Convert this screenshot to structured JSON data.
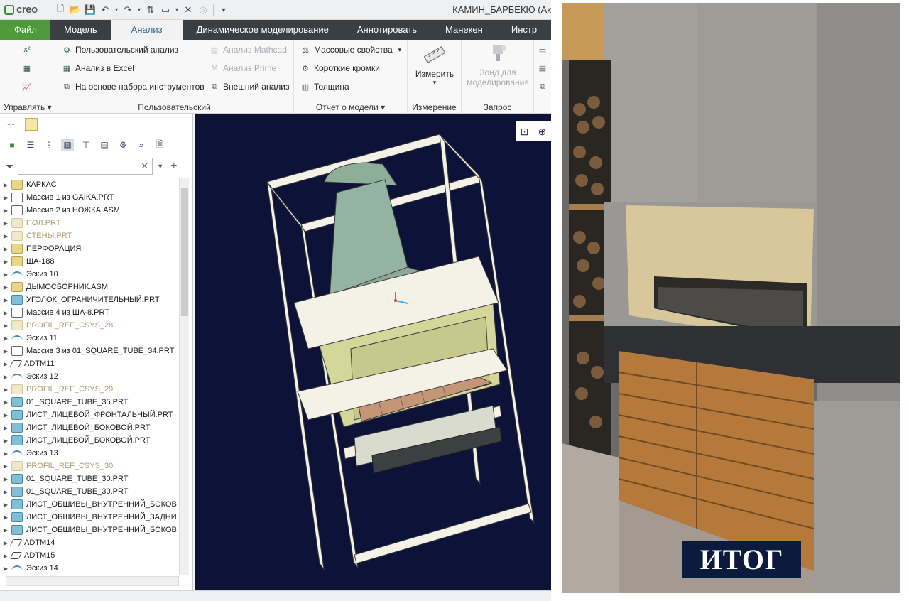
{
  "app": {
    "logo": "creo",
    "window_title": "КАМИН_БАРБЕКЮ (Ак"
  },
  "tabs": [
    {
      "label": "Файл"
    },
    {
      "label": "Модель"
    },
    {
      "label": "Анализ"
    },
    {
      "label": "Динамическое моделирование"
    },
    {
      "label": "Аннотировать"
    },
    {
      "label": "Манекен"
    },
    {
      "label": "Инстр"
    }
  ],
  "ribbon": {
    "manage_label": "Управлять",
    "custom": {
      "user_analysis": "Пользовательский анализ",
      "excel_analysis": "Анализ в Excel",
      "toolkit_analysis": "На основе набора инструментов",
      "mathcad_analysis": "Анализ Mathcad",
      "prime_analysis": "Анализ Prime",
      "external_analysis": "Внешний анализ",
      "group_label": "Пользовательский"
    },
    "model_report": {
      "mass_props": "Массовые свойства",
      "short_edges": "Короткие кромки",
      "thickness": "Толщина",
      "group_label": "Отчет о модели"
    },
    "measure": {
      "button": "Измерить",
      "group_label": "Измерение"
    },
    "query": {
      "button_line1": "Зонд для",
      "button_line2": "моделирования",
      "group_label": "Запрос"
    }
  },
  "tree": {
    "items": [
      {
        "label": "КАРКАС",
        "icon": "asm",
        "dim": false
      },
      {
        "label": "Массив 1 из GAIKA.PRT",
        "icon": "patt",
        "dim": false
      },
      {
        "label": "Массив 2 из НОЖКА.ASM",
        "icon": "patt",
        "dim": false
      },
      {
        "label": "ПОЛ.PRT",
        "icon": "ghost",
        "dim": true
      },
      {
        "label": "СТЕНЫ.PRT",
        "icon": "ghost",
        "dim": true
      },
      {
        "label": "ПЕРФОРАЦИЯ",
        "icon": "asm",
        "dim": false
      },
      {
        "label": "ША-188",
        "icon": "asm",
        "dim": false
      },
      {
        "label": "Эскиз 10",
        "icon": "sketch",
        "dim": false
      },
      {
        "label": "ДЫМОСБОРНИК.ASM",
        "icon": "asm",
        "dim": false
      },
      {
        "label": "УГОЛОК_ОГРАНИЧИТЕЛЬНЫЙ.PRT",
        "icon": "part",
        "dim": false
      },
      {
        "label": "Массив 4 из ША-8.PRT",
        "icon": "patt",
        "dim": false
      },
      {
        "label": "Эскиз 11",
        "icon": "sketch",
        "dim": false
      },
      {
        "label": "Массив 3 из 01_SQUARE_TUBE_34.PRT",
        "icon": "patt",
        "dim": false
      },
      {
        "label": "ADTM11",
        "icon": "dtm",
        "dim": false
      },
      {
        "label": "Эскиз 12",
        "icon": "sketch",
        "dim": false
      },
      {
        "label": "PROFIL_REF_CSYS_29",
        "icon": "ghost",
        "dim": true
      },
      {
        "label": "01_SQUARE_TUBE_35.PRT",
        "icon": "part",
        "dim": false
      },
      {
        "label": "ЛИСТ_ЛИЦЕВОЙ_ФРОНТАЛЬНЫЙ.PRT",
        "icon": "part",
        "dim": false
      },
      {
        "label": "ЛИСТ_ЛИЦЕВОЙ_БОКОВОЙ.PRT",
        "icon": "part",
        "dim": false
      },
      {
        "label": "ЛИСТ_ЛИЦЕВОЙ_БОКОВОЙ.PRT",
        "icon": "part",
        "dim": false
      },
      {
        "label": "Эскиз 13",
        "icon": "sketch",
        "dim": false
      },
      {
        "label": "PROFIL_REF_CSYS_30",
        "icon": "ghost",
        "dim": true
      },
      {
        "label": "01_SQUARE_TUBE_30.PRT",
        "icon": "part",
        "dim": false
      },
      {
        "label": "01_SQUARE_TUBE_30.PRT",
        "icon": "part",
        "dim": false
      },
      {
        "label": "ЛИСТ_ОБШИВЫ_ВНУТРЕННИЙ_БОКОВ",
        "icon": "part",
        "dim": false
      },
      {
        "label": "ЛИСТ_ОБШИВЫ_ВНУТРЕННИЙ_ЗАДНИ",
        "icon": "part",
        "dim": false
      },
      {
        "label": "ЛИСТ_ОБШИВЫ_ВНУТРЕННИЙ_БОКОВ",
        "icon": "part",
        "dim": false
      },
      {
        "label": "ADTM14",
        "icon": "dtm",
        "dim": false
      },
      {
        "label": "ADTM15",
        "icon": "dtm",
        "dim": false
      },
      {
        "label": "Эскиз 14",
        "icon": "sketch",
        "dim": false
      }
    ],
    "extra_dim_row": "PROFIL_REF_CSYS_28"
  },
  "photo": {
    "caption": "ИТОГ"
  },
  "colors": {
    "file_tab": "#4e9a3a",
    "tabbar": "#3a3f44",
    "viewport_bg": "#0d1338",
    "caption_bg": "#0b1a3d"
  }
}
